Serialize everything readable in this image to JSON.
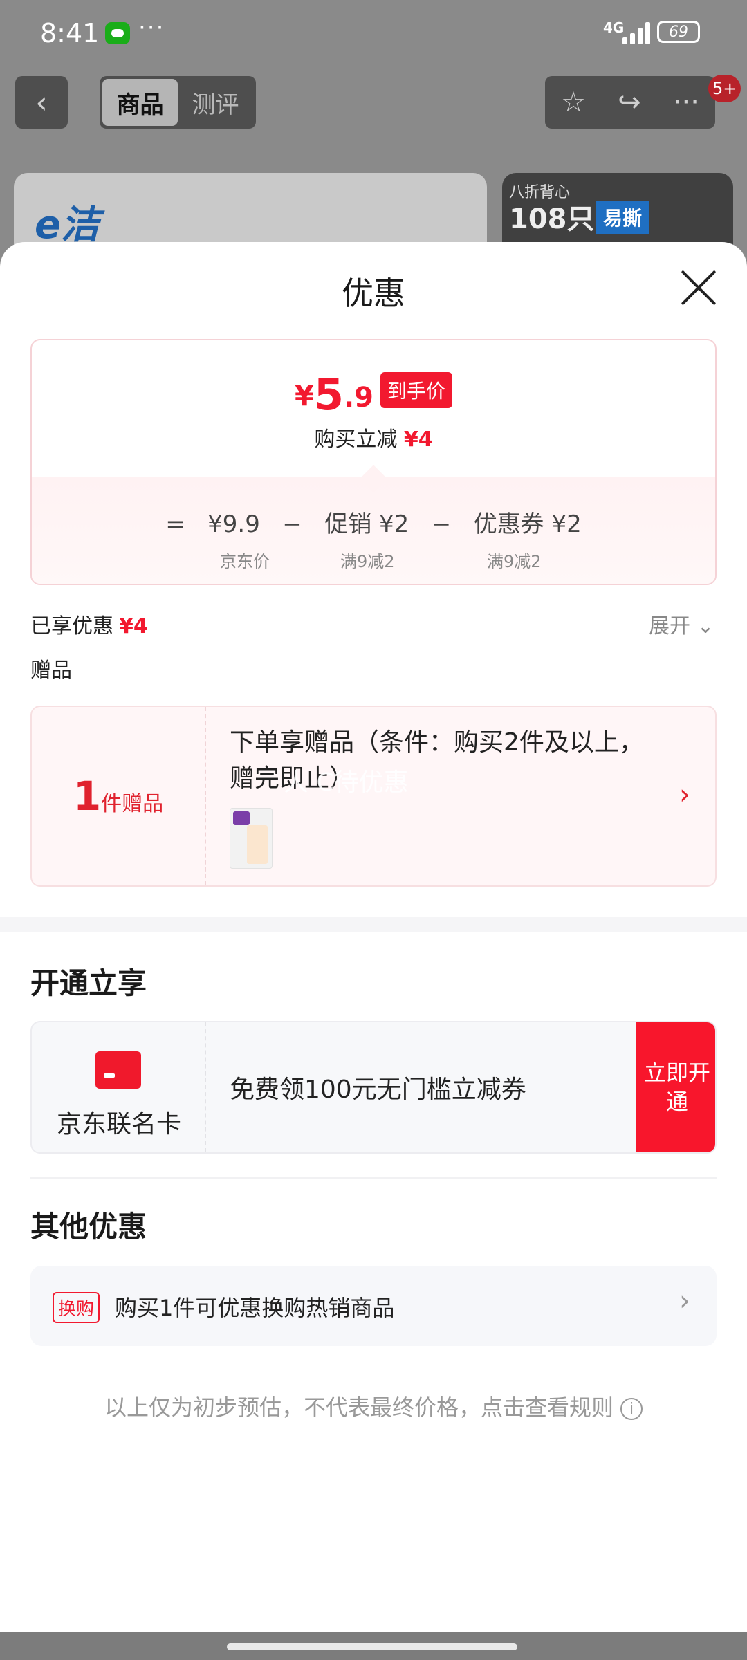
{
  "status": {
    "time": "8:41",
    "dots": "···",
    "network": "4G",
    "battery": "69"
  },
  "nav": {
    "back_icon": "‹",
    "tabs": [
      {
        "label": "商品"
      },
      {
        "label": "测评"
      }
    ],
    "star_icon": "☆",
    "share_icon": "↪",
    "more_icon": "···",
    "badge": "5+"
  },
  "banner": {
    "left_logo": "e洁",
    "right_small": "八折背心",
    "right_big": "108只",
    "right_tag": "易撕"
  },
  "sheet": {
    "title": "优惠",
    "price": {
      "symbol": "¥",
      "integer": "5",
      "decimal": ".9",
      "tag": "到手价",
      "sub_label": "购买立减",
      "sub_value": "¥4"
    },
    "formula": {
      "eq": "=",
      "jd_price": "¥9.9",
      "minus1": "−",
      "promo": "促销 ¥2",
      "minus2": "−",
      "coupon": "优惠券 ¥2",
      "jd_price_label": "京东价",
      "promo_label": "满9减2",
      "coupon_label": "满9减2"
    },
    "enjoyed_label": "已享优惠",
    "enjoyed_value": "¥4",
    "expand_label": "展开 ⌄",
    "gift_heading": "赠品",
    "gift": {
      "num": "1",
      "unit": "件赠品",
      "text": "下单享赠品（条件：购买2件及以上，赠完即止）",
      "arrow": "›",
      "watermark": "人 C待优惠"
    },
    "open_heading": "开通立享",
    "card": {
      "name": "京东联名卡",
      "desc": "免费领100元无门槛立减券",
      "button": "立即开通"
    },
    "other_heading": "其他优惠",
    "other": {
      "tag": "换购",
      "text": "购买1件可优惠换购热销商品",
      "arrow": "›"
    },
    "footer_note": "以上仅为初步预估，不代表最终价格，点击查看规则",
    "info_icon": "i"
  },
  "colors": {
    "accent_red": "#f2192f",
    "overlay": "#7a7a7a"
  }
}
